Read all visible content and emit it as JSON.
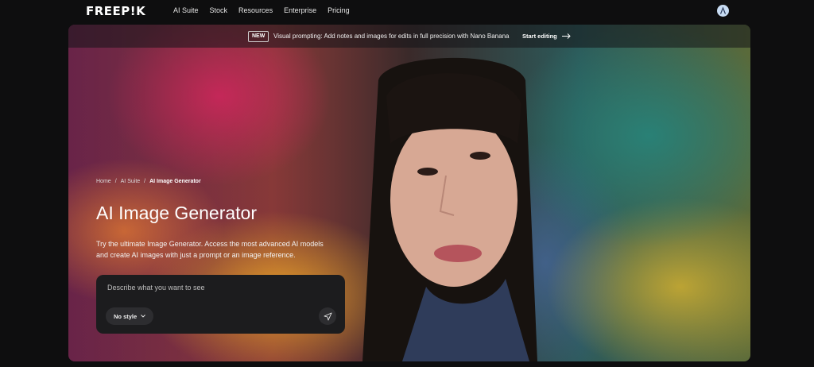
{
  "nav": {
    "logo": "FREEP!K",
    "links": [
      "AI Suite",
      "Stock",
      "Resources",
      "Enterprise",
      "Pricing"
    ],
    "avatar_icon": "user-avatar-icon"
  },
  "banner": {
    "badge": "NEW",
    "text": "Visual prompting: Add notes and images for edits in full precision with Nano Banana",
    "cta": "Start editing",
    "cta_icon": "arrow-right-icon"
  },
  "hero": {
    "breadcrumb": [
      "Home",
      "AI Suite",
      "AI Image Generator"
    ],
    "title": "AI Image Generator",
    "subtitle": "Try the ultimate Image Generator. Access the most advanced AI models and create AI images with just a prompt or an image reference.",
    "prompt": {
      "placeholder": "Describe what you want to see",
      "style_label": "No style",
      "style_icon": "chevron-down-icon",
      "send_icon": "send-icon"
    }
  },
  "colors": {
    "background": "#0e0e0f",
    "prompt_box": "#1c1c1e",
    "button": "#2d2d30"
  }
}
